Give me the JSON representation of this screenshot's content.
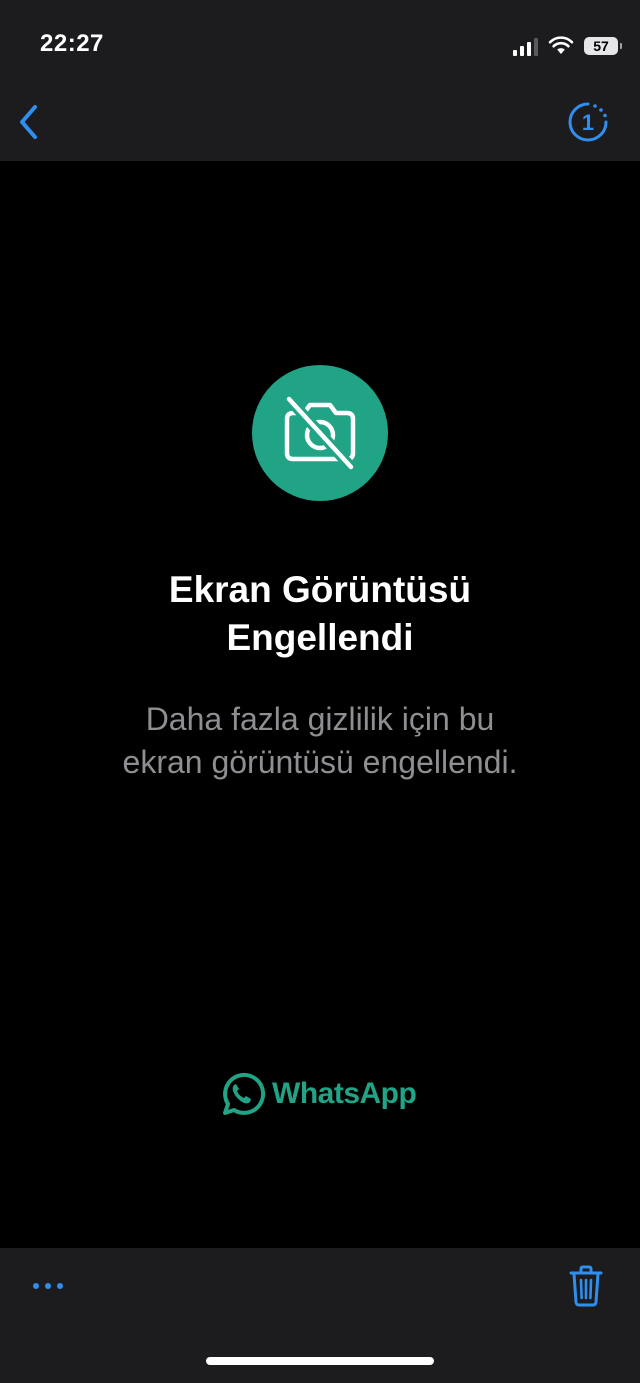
{
  "status_bar": {
    "time": "22:27",
    "battery_level": "57",
    "signal_bars_active": 3,
    "signal_bars_total": 4,
    "icons": [
      "cellular-signal-icon",
      "wifi-icon",
      "battery-icon"
    ]
  },
  "nav_bar": {
    "back_icon": "chevron-left-icon",
    "view_once_icon": "view-once-icon",
    "view_once_count": "1"
  },
  "main": {
    "badge_icon": "camera-off-icon",
    "title_line1": "Ekran Görüntüsü",
    "title_line2": "Engellendi",
    "subtitle_line1": "Daha fazla gizlilik için bu",
    "subtitle_line2": "ekran görüntüsü engellendi.",
    "brand_icon": "whatsapp-logo-icon",
    "brand_name": "WhatsApp"
  },
  "bottom_bar": {
    "more_icon": "ellipsis-icon",
    "delete_icon": "trash-icon"
  },
  "colors": {
    "accent_blue": "#2f8ef0",
    "whatsapp_green": "#21a386",
    "bar_background": "#1c1c1e",
    "page_background": "#000000",
    "subtitle_gray": "#8e8e93"
  }
}
